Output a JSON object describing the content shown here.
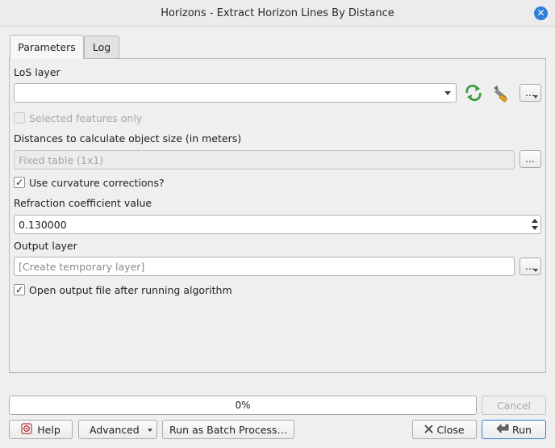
{
  "window": {
    "title": "Horizons - Extract Horizon Lines By Distance"
  },
  "tabs": [
    {
      "label": "Parameters",
      "active": true
    },
    {
      "label": "Log",
      "active": false
    }
  ],
  "params": {
    "los_layer_label": "LoS layer",
    "los_layer_value": "",
    "selected_features_label": "Selected features only",
    "distances_label": "Distances to calculate object size (in meters)",
    "distances_value": "Fixed table (1x1)",
    "curvature_label": "Use curvature corrections?",
    "curvature_checked": true,
    "refraction_label": "Refraction coefficient value",
    "refraction_value": "0.130000",
    "output_label": "Output layer",
    "output_placeholder": "[Create temporary layer]",
    "open_output_label": "Open output file after running algorithm",
    "open_output_checked": true,
    "ellipsis": "…"
  },
  "progress": {
    "text": "0%",
    "value": 0
  },
  "buttons": {
    "cancel": "Cancel",
    "help": "Help",
    "advanced": "Advanced",
    "batch": "Run as Batch Process…",
    "close": "Close",
    "run": "Run"
  },
  "colors": {
    "accent": "#2f7fd6",
    "refresh_icon": "#3a9a3a"
  }
}
